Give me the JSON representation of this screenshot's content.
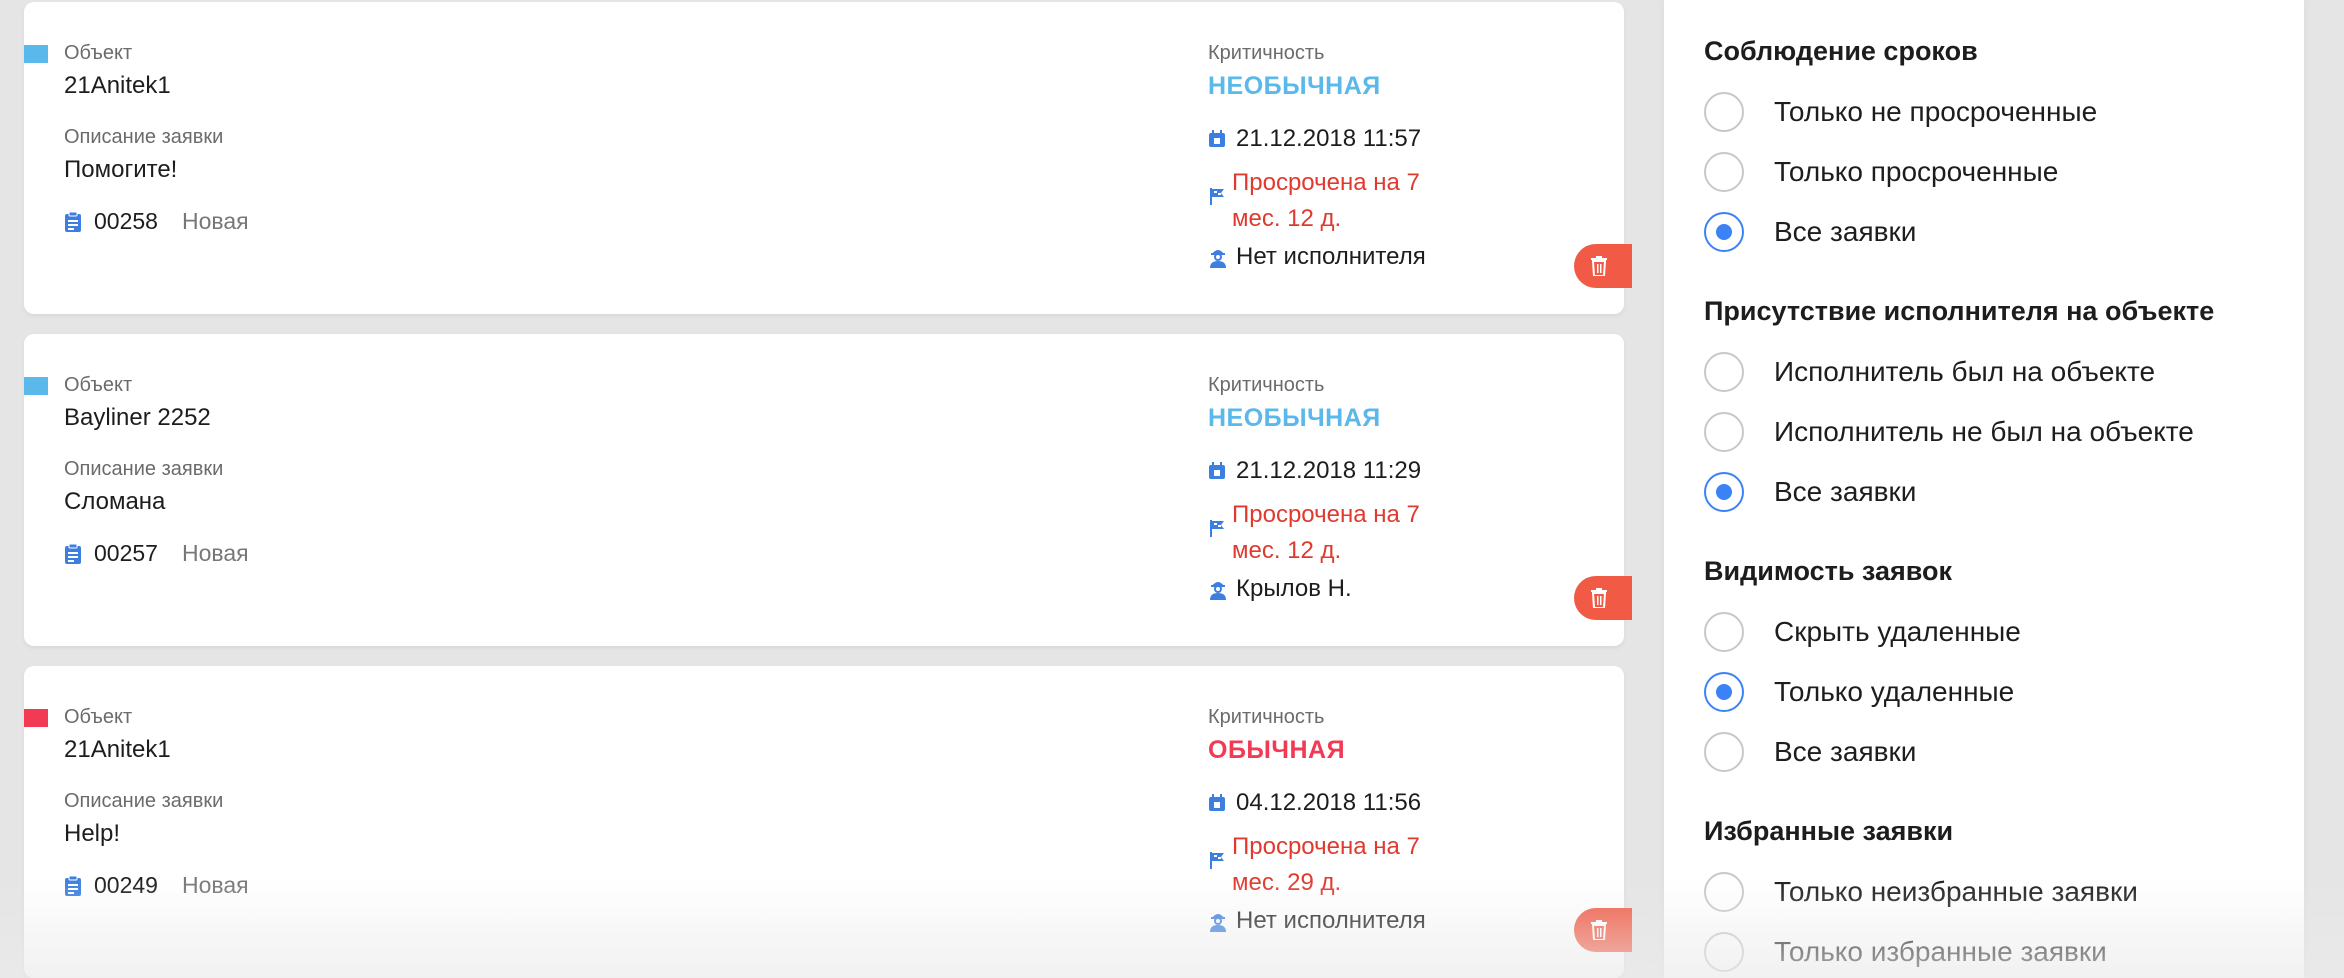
{
  "requests": [
    {
      "marker_color": "#5bb8ea",
      "object_label": "Объект",
      "object": "21Anitek1",
      "description_label": "Описание заявки",
      "description": "Помогите!",
      "number": "00258",
      "status": "Новая",
      "criticality_label": "Критичность",
      "criticality": "НЕОБЫЧНАЯ",
      "criticality_color": "#5bb8ea",
      "date": "21.12.2018 11:57",
      "overdue": "Просрочена на 7 мес. 12 д.",
      "executor": "Нет исполнителя"
    },
    {
      "marker_color": "#5bb8ea",
      "object_label": "Объект",
      "object": "Bayliner 2252",
      "description_label": "Описание заявки",
      "description": "Сломана",
      "number": "00257",
      "status": "Новая",
      "criticality_label": "Критичность",
      "criticality": "НЕОБЫЧНАЯ",
      "criticality_color": "#5bb8ea",
      "date": "21.12.2018 11:29",
      "overdue": "Просрочена на 7 мес. 12 д.",
      "executor": "Крылов Н."
    },
    {
      "marker_color": "#f23a55",
      "object_label": "Объект",
      "object": "21Anitek1",
      "description_label": "Описание заявки",
      "description": "Help!",
      "number": "00249",
      "status": "Новая",
      "criticality_label": "Критичность",
      "criticality": "ОБЫЧНАЯ",
      "criticality_color": "#f23a55",
      "date": "04.12.2018 11:56",
      "overdue": "Просрочена на 7 мес. 29 д.",
      "executor": "Нет исполнителя"
    }
  ],
  "filters": {
    "deadlines": {
      "title": "Соблюдение сроков",
      "options": [
        "Только не просроченные",
        "Только просроченные",
        "Все заявки"
      ],
      "selected": 2
    },
    "presence": {
      "title": "Присутствие исполнителя на объекте",
      "options": [
        "Исполнитель был на объекте",
        "Исполнитель не был на объекте",
        "Все заявки"
      ],
      "selected": 2
    },
    "visibility": {
      "title": "Видимость заявок",
      "options": [
        "Скрыть удаленные",
        "Только удаленные",
        "Все заявки"
      ],
      "selected": 1
    },
    "favorites": {
      "title": "Избранные заявки",
      "options": [
        "Только неизбранные заявки",
        "Только избранные заявки"
      ],
      "selected": -1
    }
  },
  "colors": {
    "accent": "#3b82f6",
    "overdue": "#e03a2f",
    "delete_button": "#f15a44",
    "icon_blue": "#3d7fe0"
  },
  "icons": {
    "number": "clipboard-icon",
    "date": "calendar-icon",
    "overdue": "flag-icon",
    "executor": "worker-icon",
    "delete": "trash-icon"
  }
}
